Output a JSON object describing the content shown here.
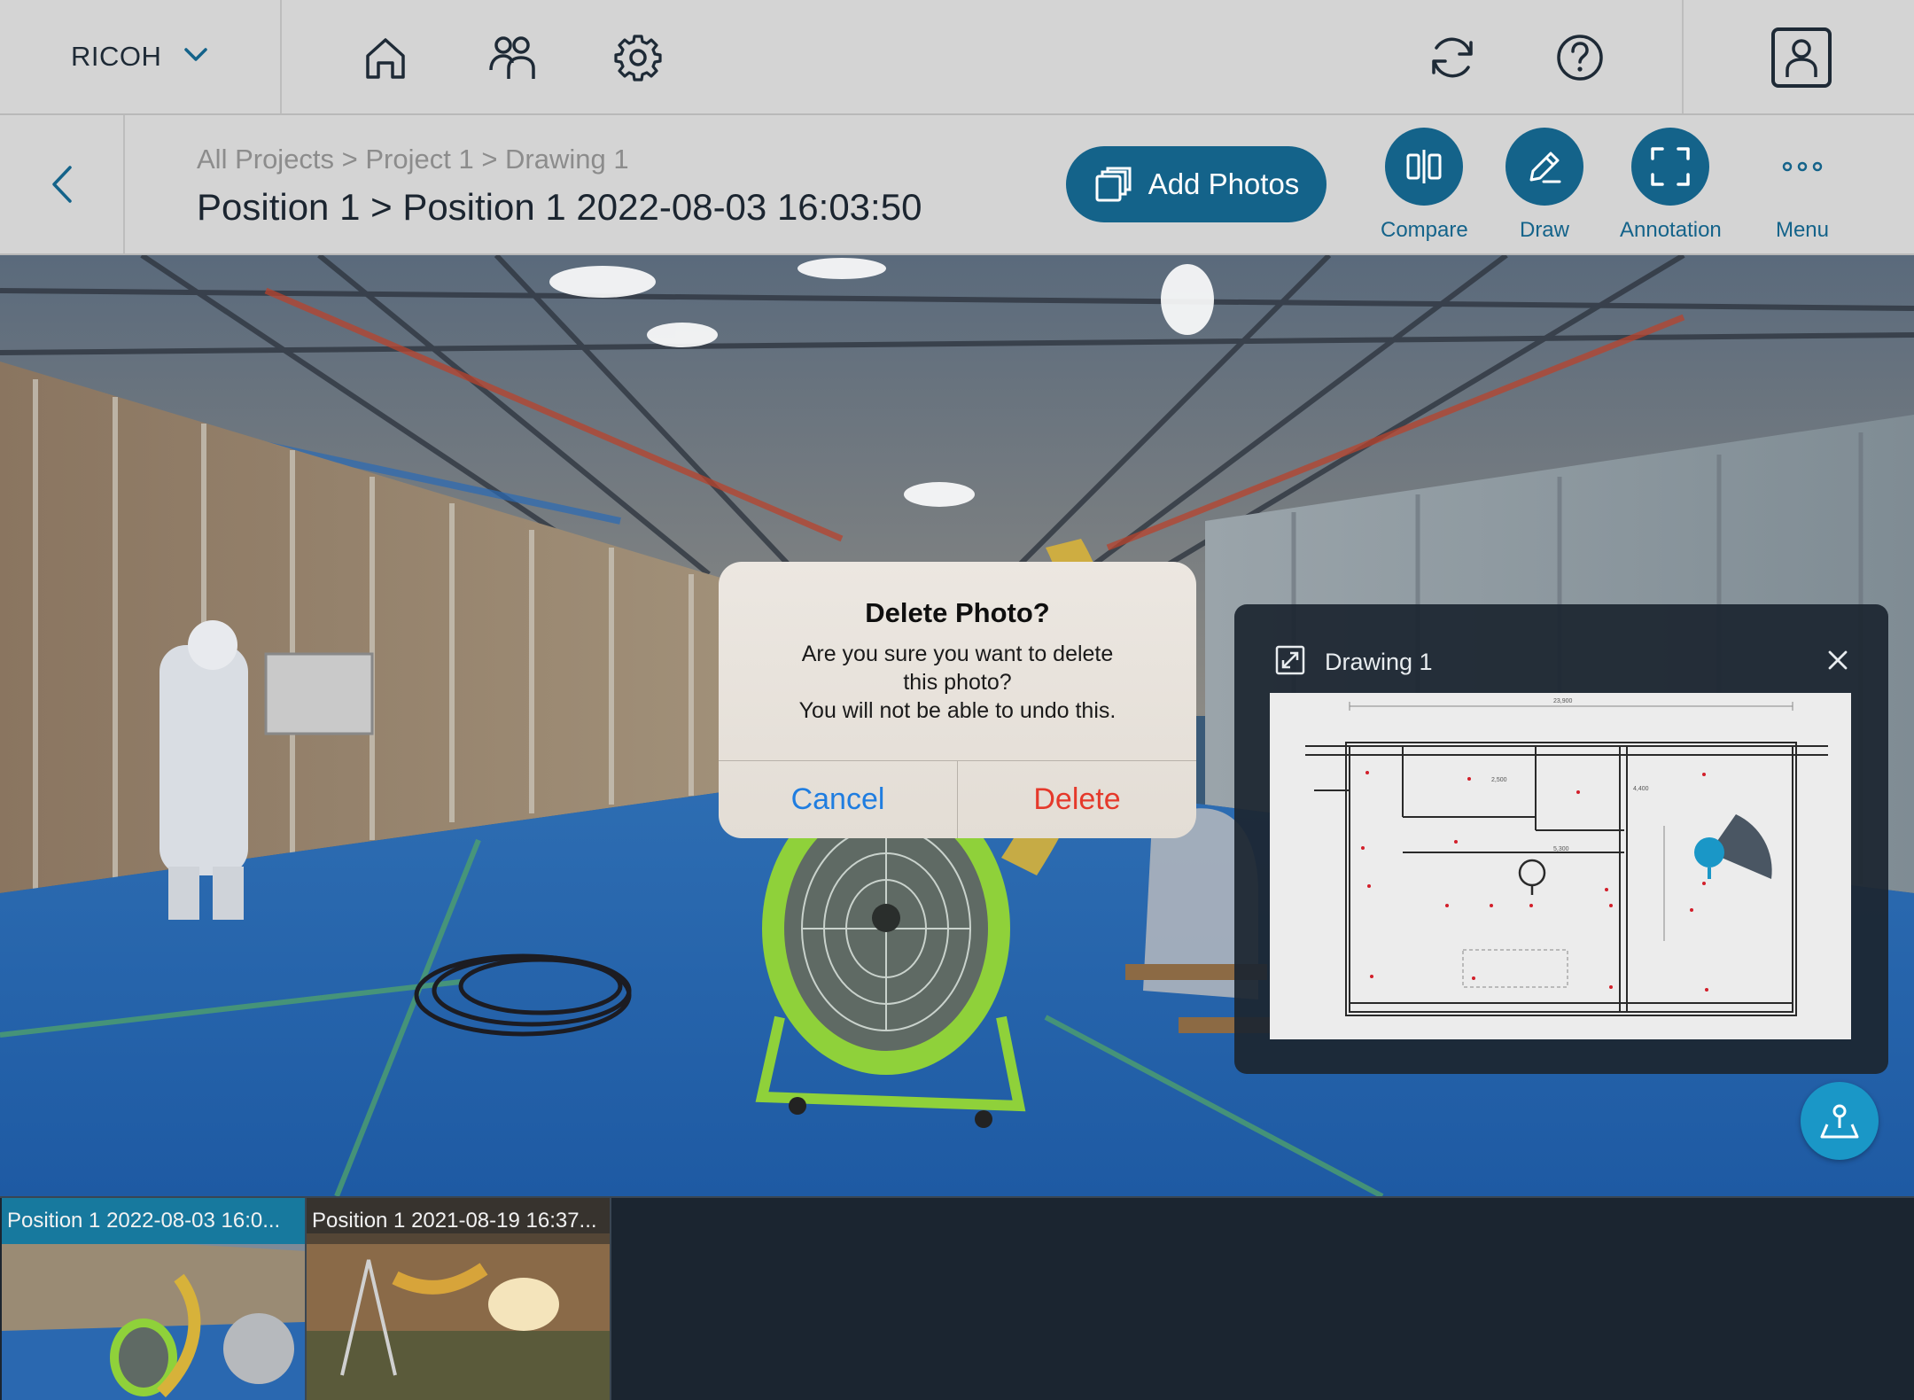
{
  "app": {
    "brand": "RICOH",
    "brand_icon": "chevron-down-icon",
    "nav_icons": [
      "home-icon",
      "users-icon",
      "settings-gear-icon"
    ],
    "right_icons": [
      "sync-icon",
      "help-icon"
    ],
    "user_icon": "user-profile-icon"
  },
  "header": {
    "breadcrumb": "All Projects > Project 1 > Drawing 1",
    "title": "Position 1 > Position 1 2022-08-03 16:03:50",
    "add_photos_label": "Add Photos",
    "tools": [
      {
        "label": "Compare",
        "icon": "compare-icon"
      },
      {
        "label": "Draw",
        "icon": "pencil-icon"
      },
      {
        "label": "Annotation",
        "icon": "annotation-frame-icon"
      },
      {
        "label": "Menu",
        "icon": "more-dots-icon"
      }
    ],
    "accent_color": "#14638a"
  },
  "dialog": {
    "title": "Delete Photo?",
    "message_lines": [
      "Are you sure you want to delete",
      "this photo?",
      "You will not be able to undo this."
    ],
    "cancel_label": "Cancel",
    "delete_label": "Delete",
    "cancel_color": "#1f7de0",
    "delete_color": "#e5392b"
  },
  "minimap": {
    "title": "Drawing 1",
    "expand_icon": "expand-icon",
    "close_icon": "close-icon",
    "plan_dimension_labels": [
      "23,900",
      "2,500",
      "4,400",
      "5,300"
    ]
  },
  "locate_button_icon": "map-locate-icon",
  "filmstrip": [
    {
      "caption": "Position 1 2022-08-03 16:0...",
      "active": true
    },
    {
      "caption": "Position 1 2021-08-19 16:37...",
      "active": false
    }
  ]
}
